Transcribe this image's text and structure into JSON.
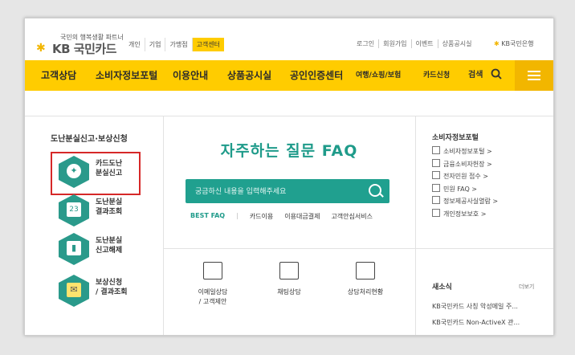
{
  "brand": {
    "tagline": "국민의 행복생활 파트너",
    "logo_text": "KB 국민카드",
    "bank_link": "KB국민은행"
  },
  "top_tabs": [
    {
      "label": "개인",
      "active": false
    },
    {
      "label": "기업",
      "active": false
    },
    {
      "label": "가맹점",
      "active": false
    },
    {
      "label": "고객센터",
      "active": true
    }
  ],
  "utility_links": [
    "로그인",
    "회원가입",
    "이벤트",
    "상품공시실"
  ],
  "nav": {
    "items": [
      "고객상담",
      "소비자정보포털",
      "이용안내",
      "상품공시실",
      "공인인증센터",
      "여행/쇼핑/보험",
      "카드신청"
    ],
    "search_label": "검색",
    "accent_color": "#ffcc00"
  },
  "left_panel": {
    "title": "도난분실신고·보상신청",
    "items": [
      {
        "label": "카드도난\n분실신고",
        "icon": "card-icon",
        "highlighted": true
      },
      {
        "label": "도난분실\n결과조회",
        "icon": "calendar-icon",
        "highlighted": false
      },
      {
        "label": "도난분실\n신고해제",
        "icon": "chart-icon",
        "highlighted": false
      },
      {
        "label": "보상신청\n/ 결과조회",
        "icon": "envelope-icon",
        "highlighted": false
      }
    ]
  },
  "faq": {
    "title": "자주하는 질문 FAQ",
    "search_placeholder": "궁금하신 내용을 입력해주세요",
    "tags": [
      "BEST FAQ",
      "카드이용",
      "이용대금결제",
      "고객안심서비스"
    ],
    "accent_color": "#1f9b8a"
  },
  "services": [
    {
      "label": "이메일상담\n/ 고객제안",
      "icon": "email-icon"
    },
    {
      "label": "채팅상담",
      "icon": "chat-icon"
    },
    {
      "label": "상담처리현황",
      "icon": "document-search-icon"
    }
  ],
  "right_panel": {
    "title": "소비자정보포털",
    "links": [
      "소비자정보포털 >",
      "금융소비자헌장 >",
      "전자민원 접수 >",
      "민원 FAQ >",
      "정보제공사실열람 >",
      "개인정보보호 >"
    ],
    "news_title": "새소식",
    "news_more": "더보기",
    "news": [
      "KB국민카드 사칭 악성메일 주...",
      "KB국민카드 Non-ActiveX 관..."
    ]
  }
}
